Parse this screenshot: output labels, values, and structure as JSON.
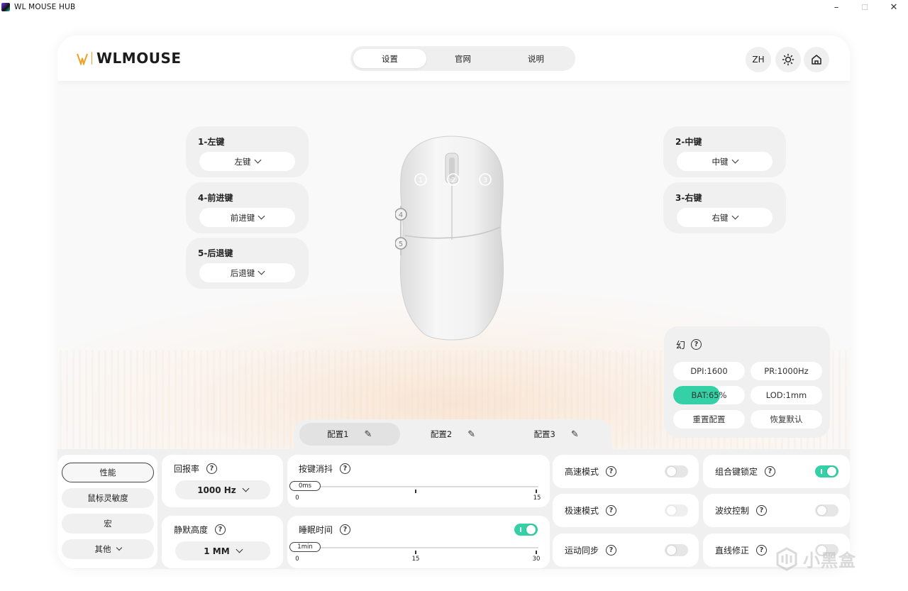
{
  "window": {
    "title": "WL MOUSE HUB",
    "controls": {
      "minimize": "–",
      "maximize": "☐",
      "close": "✕"
    }
  },
  "header": {
    "logo_text": "WLMOUSE",
    "tabs": [
      {
        "label": "设置",
        "active": true
      },
      {
        "label": "官网",
        "active": false
      },
      {
        "label": "说明",
        "active": false
      }
    ],
    "lang_label": "ZH",
    "theme_icon": "sun-icon",
    "home_icon": "home-icon"
  },
  "buttons": {
    "b1": {
      "title": "1-左键",
      "value": "左键"
    },
    "b2": {
      "title": "2-中键",
      "value": "中键"
    },
    "b3": {
      "title": "3-右键",
      "value": "右键"
    },
    "b4": {
      "title": "4-前进键",
      "value": "前进键"
    },
    "b5": {
      "title": "5-后退键",
      "value": "后退键"
    }
  },
  "mouse_markers": [
    "1",
    "2",
    "3",
    "4",
    "5"
  ],
  "device": {
    "name": "幻",
    "dpi": "DPI:1600",
    "polling": "PR:1000Hz",
    "battery": "BAT:65%",
    "battery_level": 0.65,
    "lod": "LOD:1mm",
    "reset_config": "重置配置",
    "restore_default": "恢复默认",
    "accent_color": "#34d0a6"
  },
  "profiles": [
    {
      "label": "配置1",
      "active": true
    },
    {
      "label": "配置2",
      "active": false
    },
    {
      "label": "配置3",
      "active": false
    }
  ],
  "sidebar": {
    "items": [
      {
        "label": "性能",
        "active": true
      },
      {
        "label": "鼠标灵敏度",
        "active": false
      },
      {
        "label": "宏",
        "active": false
      },
      {
        "label": "其他",
        "active": false
      }
    ]
  },
  "settings": {
    "polling_rate": {
      "label": "回报率",
      "value": "1000 Hz"
    },
    "lift_off": {
      "label": "静默高度",
      "value": "1 MM"
    },
    "debounce": {
      "label": "按键消抖",
      "value": "0ms",
      "ticks": [
        "0",
        "15"
      ]
    },
    "sleep": {
      "label": "睡眠时间",
      "value": "1min",
      "ticks": [
        "0",
        "15",
        "30"
      ],
      "enabled": true
    },
    "toggles": {
      "high_speed": {
        "label": "高速模式",
        "on": false
      },
      "ultra_speed": {
        "label": "极速模式",
        "on": false
      },
      "motion_sync": {
        "label": "运动同步",
        "on": false
      },
      "combo_lock": {
        "label": "组合键锁定",
        "on": true
      },
      "ripple": {
        "label": "波纹控制",
        "on": false
      },
      "angle_snap": {
        "label": "直线修正",
        "on": false
      }
    }
  },
  "watermark": "小黑盒"
}
